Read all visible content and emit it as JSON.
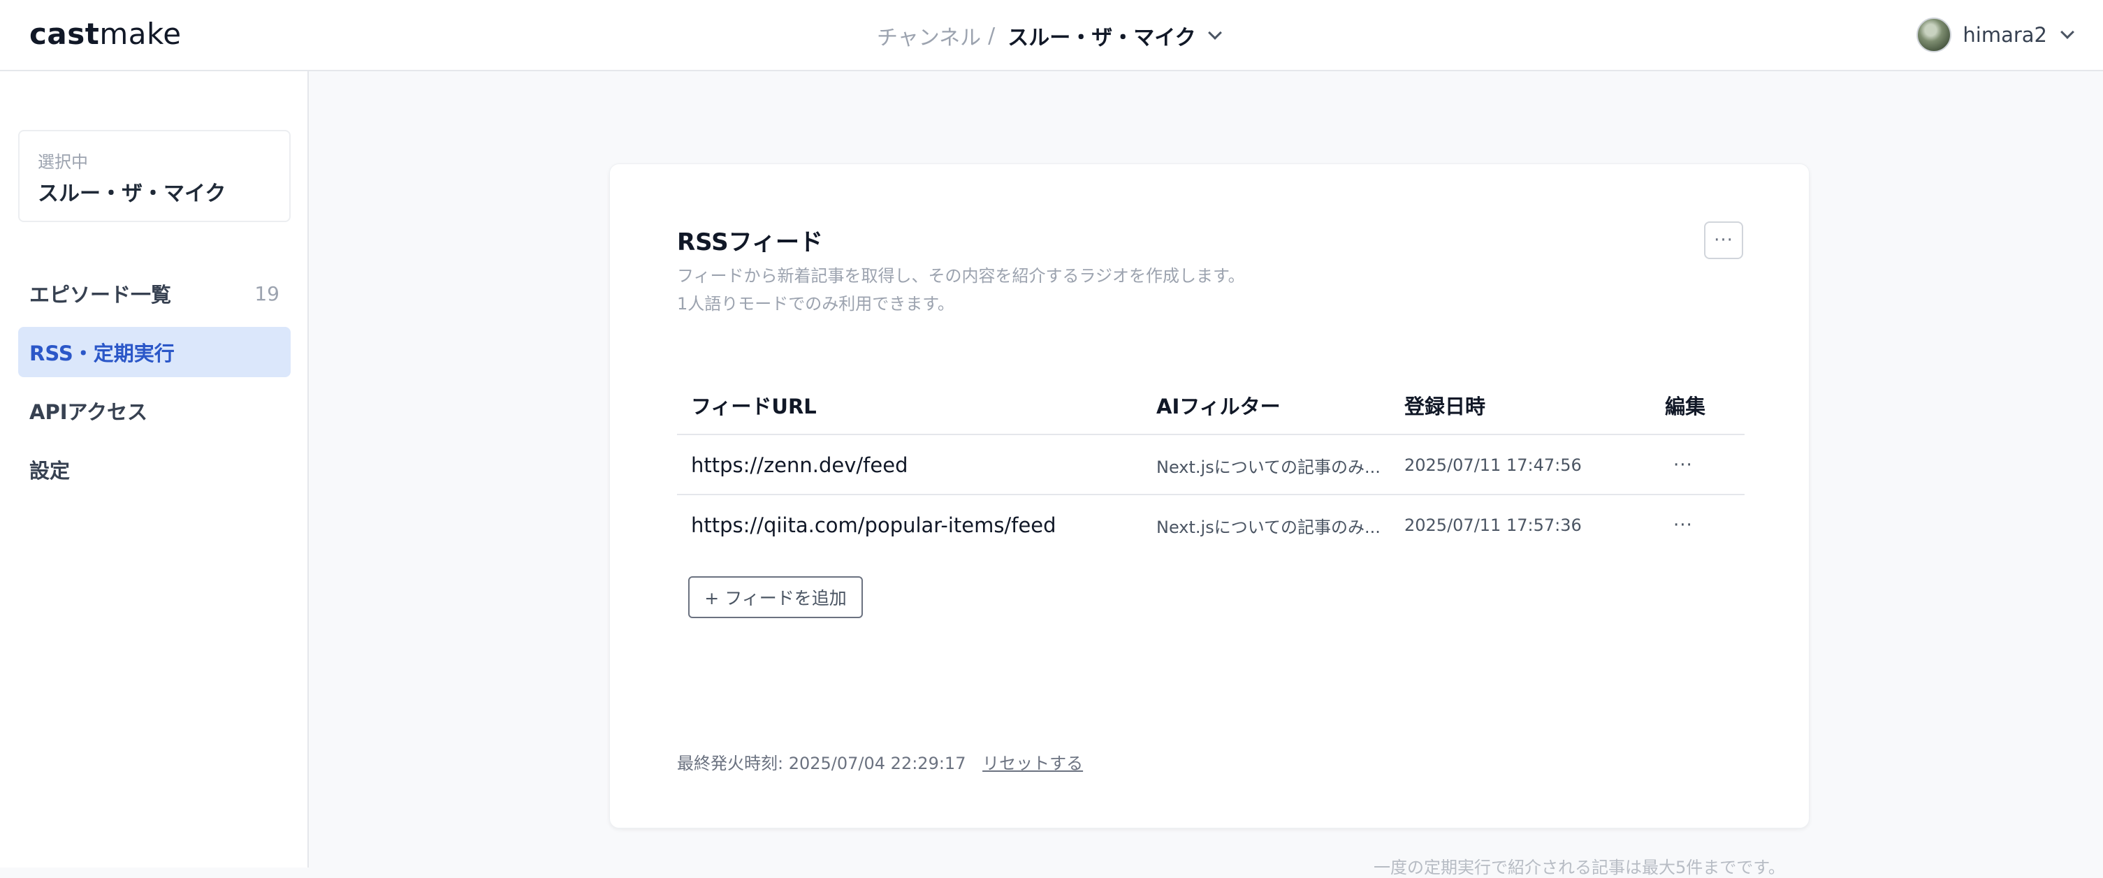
{
  "header": {
    "logo_bold": "cast",
    "logo_light": "make",
    "breadcrumb_parent": "チャンネル",
    "breadcrumb_sep": "/",
    "breadcrumb_current": "スルー・ザ・マイク",
    "user_name": "himara2"
  },
  "sidebar": {
    "selected_caption": "選択中",
    "selected_name": "スルー・ザ・マイク",
    "items": [
      {
        "label": "エピソード一覧",
        "count": "19"
      },
      {
        "label": "RSS・定期実行",
        "count": ""
      },
      {
        "label": "APIアクセス",
        "count": ""
      },
      {
        "label": "設定",
        "count": ""
      }
    ]
  },
  "main": {
    "title": "RSSフィード",
    "desc_line1": "フィードから新着記事を取得し、その内容を紹介するラジオを作成します。",
    "desc_line2": "1人語りモードでのみ利用できます。",
    "more_label": "···",
    "columns": [
      "フィードURL",
      "AIフィルター",
      "登録日時",
      "編集"
    ],
    "rows": [
      {
        "url": "https://zenn.dev/feed",
        "filter": "Next.jsについての記事のみ...",
        "date": "2025/07/11 17:47:56",
        "menu": "···"
      },
      {
        "url": "https://qiita.com/popular-items/feed",
        "filter": "Next.jsについての記事のみ...",
        "date": "2025/07/11 17:57:36",
        "menu": "···"
      }
    ],
    "add_label": "+ フィードを追加",
    "last_fired": "最終発火時刻: 2025/07/04 22:29:17",
    "reset_label": "リセットする"
  },
  "bottom_note": "一度の定期実行で紹介される記事は最大5件までです。",
  "colors": {
    "accent": "#2b57c8",
    "active_bg": "#dbe7fb"
  }
}
